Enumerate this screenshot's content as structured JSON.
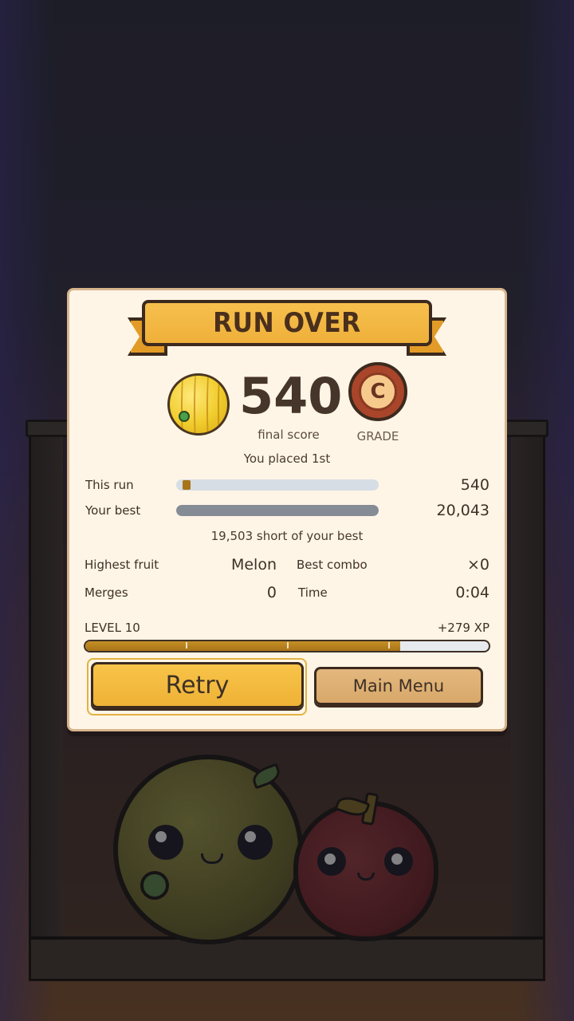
{
  "banner": {
    "title": "RUN OVER"
  },
  "score": {
    "value": "540",
    "label": "final score",
    "fruit_icon": "melon-icon"
  },
  "grade": {
    "letter": "C",
    "label": "GRADE"
  },
  "placement": "You placed 1st",
  "comparison": {
    "this_run": {
      "label": "This run",
      "value": "540",
      "fraction_of_best": 0.027
    },
    "your_best": {
      "label": "Your best",
      "value": "20,043",
      "fraction_of_best": 1.0
    },
    "note": "19,503 short of your best"
  },
  "stats": {
    "highest_fruit": {
      "label": "Highest fruit",
      "value": "Melon"
    },
    "best_combo": {
      "label": "Best combo",
      "value": "×0"
    },
    "merges": {
      "label": "Merges",
      "value": "0"
    },
    "time": {
      "label": "Time",
      "value": "0:04"
    }
  },
  "progress": {
    "level_label": "LEVEL 10",
    "xp_gain": "+279 XP",
    "fill_fraction": 0.78
  },
  "buttons": {
    "retry": "Retry",
    "main_menu": "Main Menu"
  },
  "colors": {
    "accent": "#f5b942",
    "panel": "#fff5e6",
    "bar_run": "#a8741a",
    "bar_best": "#858c96",
    "grade": "#a9452a"
  }
}
